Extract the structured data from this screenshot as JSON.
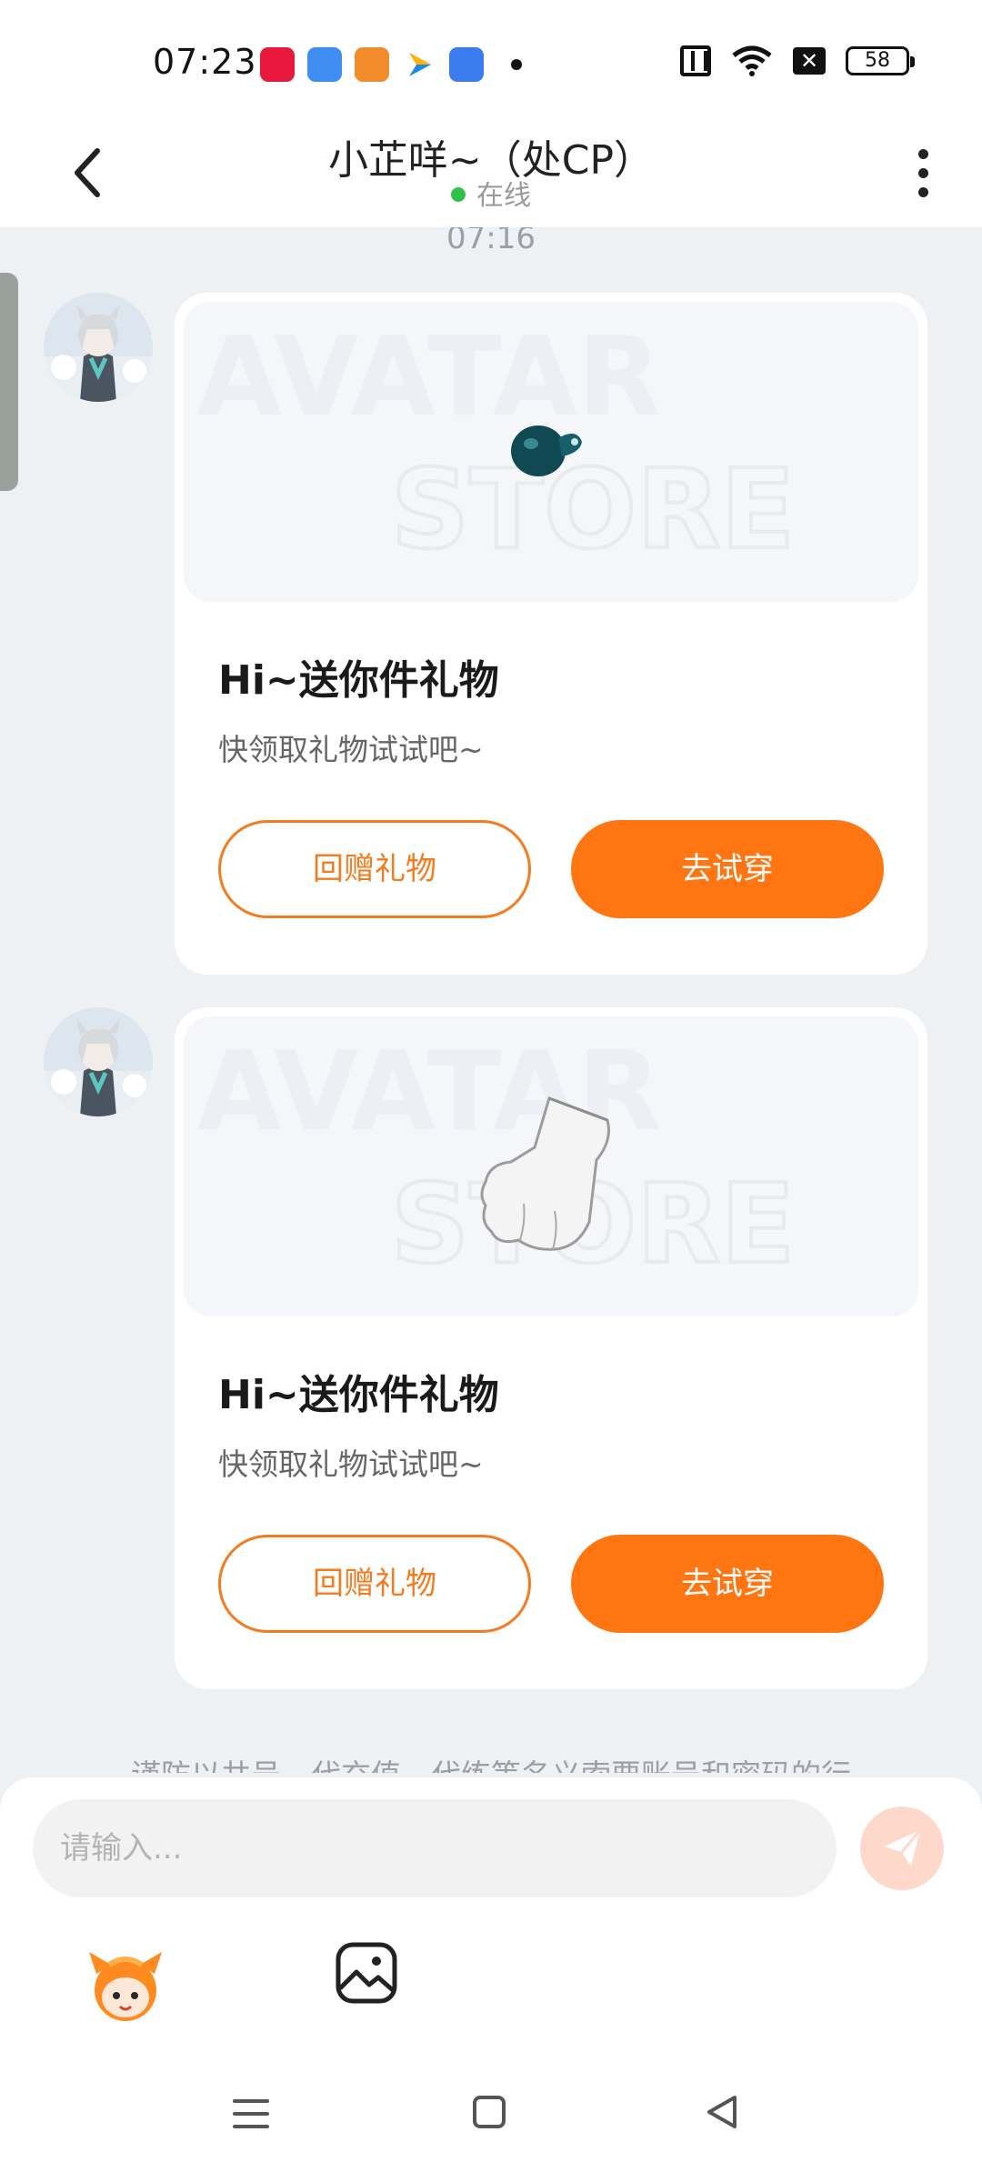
{
  "status_bar": {
    "time": "07:23",
    "battery": "58",
    "x_icon": "✕",
    "icons": [
      "xiaohongshu-icon",
      "weather-icon",
      "home-app-icon",
      "play-icon",
      "app-icon",
      "nfc-icon",
      "wifi-icon",
      "battery-icon"
    ]
  },
  "header": {
    "title": "小芷咩~（处CP）",
    "status": "在线"
  },
  "chat": {
    "timestamp": "07:16",
    "messages": [
      {
        "title": "Hi~送你件礼物",
        "desc": "快领取礼物试试吧~",
        "return_gift": "回赠礼物",
        "try_on": "去试穿",
        "watermark_top": "AVATAR",
        "watermark_bottom": "STORE"
      },
      {
        "title": "Hi~送你件礼物",
        "desc": "快领取礼物试试吧~",
        "return_gift": "回赠礼物",
        "try_on": "去试穿",
        "watermark_top": "AVATAR",
        "watermark_bottom": "STORE"
      }
    ],
    "notice": "谨防以共号、代充值、代练等名义索要账号和密码的行"
  },
  "input": {
    "placeholder": "请输入..."
  },
  "colors": {
    "accent": "#ff7512",
    "online": "#31c14b",
    "background": "#eef1f4"
  }
}
